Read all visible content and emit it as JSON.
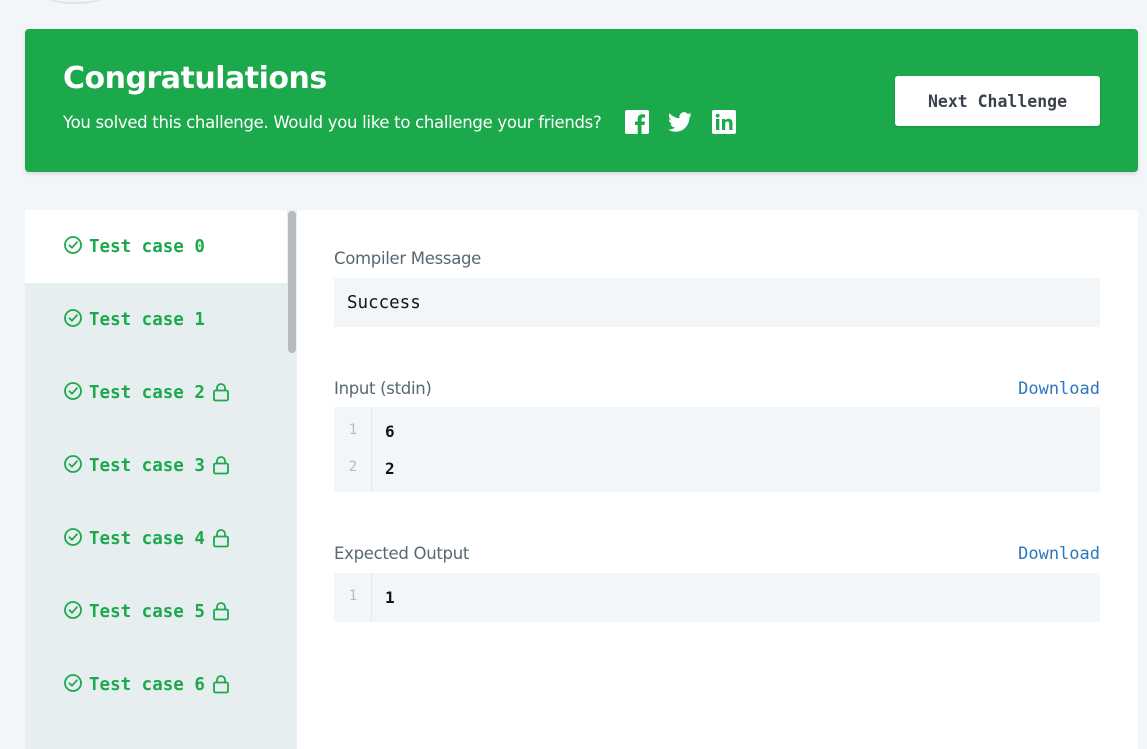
{
  "banner": {
    "title": "Congratulations",
    "subtitle": "You solved this challenge. Would you like to challenge your friends?",
    "social_icons": [
      "facebook-icon",
      "twitter-icon",
      "linkedin-icon"
    ],
    "next_label": "Next Challenge",
    "color": "#1ba94c"
  },
  "sidebar": {
    "test_cases": [
      {
        "label": "Test case 0",
        "passed": true,
        "locked": false,
        "active": true
      },
      {
        "label": "Test case 1",
        "passed": true,
        "locked": false,
        "active": false
      },
      {
        "label": "Test case 2",
        "passed": true,
        "locked": true,
        "active": false
      },
      {
        "label": "Test case 3",
        "passed": true,
        "locked": true,
        "active": false
      },
      {
        "label": "Test case 4",
        "passed": true,
        "locked": true,
        "active": false
      },
      {
        "label": "Test case 5",
        "passed": true,
        "locked": true,
        "active": false
      },
      {
        "label": "Test case 6",
        "passed": true,
        "locked": true,
        "active": false
      }
    ]
  },
  "main": {
    "compiler_label": "Compiler Message",
    "compiler_message": "Success",
    "input_label": "Input (stdin)",
    "input_download": "Download",
    "input_lines": [
      {
        "no": "1",
        "value": "6"
      },
      {
        "no": "2",
        "value": "2"
      }
    ],
    "output_label": "Expected Output",
    "output_download": "Download",
    "output_lines": [
      {
        "no": "1",
        "value": "1"
      }
    ]
  },
  "colors": {
    "success": "#1ba94c",
    "link": "#2d77bd",
    "text": "#0e141e",
    "muted": "#576871"
  }
}
